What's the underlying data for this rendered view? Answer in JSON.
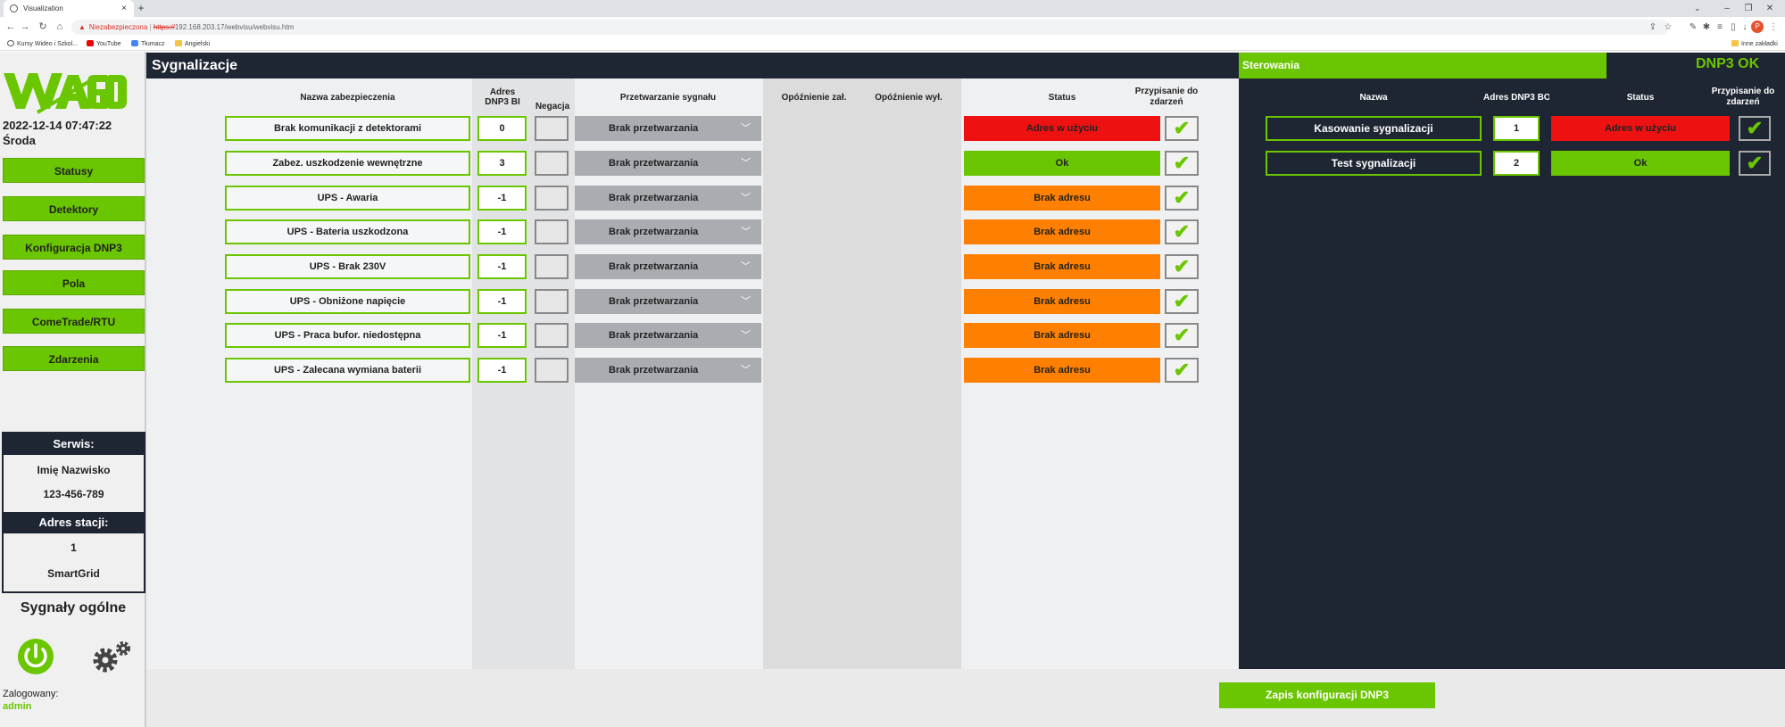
{
  "browser": {
    "tab_title": "Visualization",
    "new_tab": "+",
    "warning_label": "Niezabezpieczona",
    "url_scheme": "https://",
    "url_rest": "192.168.203.17/webvisu/webvisu.htm",
    "profile_letter": "P",
    "bookmarks": [
      "Kursy Wideo i Szkol...",
      "YouTube",
      "Tłumacz",
      "Angielski"
    ],
    "other_bookmarks": "Inne zakładki"
  },
  "sidebar": {
    "datetime": "2022-12-14 07:47:22",
    "day": "Środa",
    "nav": [
      "Statusy",
      "Detektory",
      "Konfiguracja DNP3",
      "Pola",
      "ComeTrade/RTU",
      "Zdarzenia"
    ],
    "service_title": "Serwis:",
    "service_name": "Imię Nazwisko",
    "service_phone": "123-456-789",
    "station_title": "Adres stacji:",
    "station_number": "1",
    "station_name": "SmartGrid",
    "signals_title": "Sygnały ogólne",
    "logged_label": "Zalogowany:",
    "logged_user": "admin"
  },
  "signals": {
    "header": "Sygnalizacje",
    "columns": {
      "name": "Nazwa zabezpieczenia",
      "addr_line1": "Adres",
      "addr_line2": "DNP3 BI",
      "negation": "Negacja",
      "processing": "Przetwarzanie sygnału",
      "delay_on": "Opóźnienie zał.",
      "delay_off": "Opóźnienie wył.",
      "status": "Status",
      "assign_line1": "Przypisanie do",
      "assign_line2": "zdarzeń"
    },
    "rows": [
      {
        "name": "Brak komunikacji z detektorami",
        "addr": "0",
        "processing": "Brak przetwarzania",
        "status": "Adres w użyciu",
        "status_color": "#ee1111"
      },
      {
        "name": "Zabez. uszkodzenie wewnętrzne",
        "addr": "3",
        "processing": "Brak przetwarzania",
        "status": "Ok",
        "status_color": "#6ac600"
      },
      {
        "name": "UPS - Awaria",
        "addr": "-1",
        "processing": "Brak przetwarzania",
        "status": "Brak adresu",
        "status_color": "#ff8000"
      },
      {
        "name": "UPS - Bateria uszkodzona",
        "addr": "-1",
        "processing": "Brak przetwarzania",
        "status": "Brak adresu",
        "status_color": "#ff8000"
      },
      {
        "name": "UPS - Brak 230V",
        "addr": "-1",
        "processing": "Brak przetwarzania",
        "status": "Brak adresu",
        "status_color": "#ff8000"
      },
      {
        "name": "UPS - Obniżone napięcie",
        "addr": "-1",
        "processing": "Brak przetwarzania",
        "status": "Brak adresu",
        "status_color": "#ff8000"
      },
      {
        "name": "UPS - Praca bufor. niedostępna",
        "addr": "-1",
        "processing": "Brak przetwarzania",
        "status": "Brak adresu",
        "status_color": "#ff8000"
      },
      {
        "name": "UPS - Zalecana wymiana baterii",
        "addr": "-1",
        "processing": "Brak przetwarzania",
        "status": "Brak adresu",
        "status_color": "#ff8000"
      }
    ]
  },
  "controls": {
    "header": "Sterowania",
    "dnp3_status": "DNP3 OK",
    "columns": {
      "name": "Nazwa",
      "addr": "Adres DNP3 BO",
      "status": "Status",
      "assign_line1": "Przypisanie do",
      "assign_line2": "zdarzeń"
    },
    "rows": [
      {
        "name": "Kasowanie sygnalizacji",
        "addr": "1",
        "status": "Adres w użyciu",
        "status_color": "#ee1111"
      },
      {
        "name": "Test sygnalizacji",
        "addr": "2",
        "status": "Ok",
        "status_color": "#6ac600"
      }
    ]
  },
  "save_button": "Zapis konfiguracji DNP3"
}
